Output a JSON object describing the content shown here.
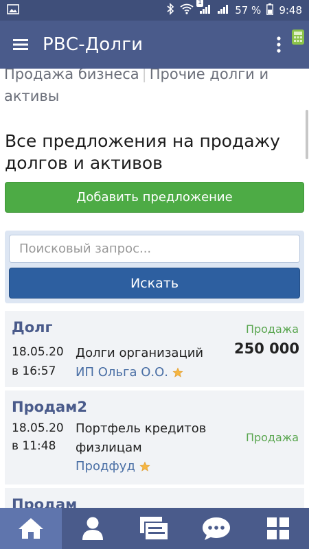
{
  "status_bar": {
    "battery": "57 %",
    "time": "9:48",
    "notification_count": "1"
  },
  "app_bar": {
    "title": "РВС-Долги"
  },
  "categories": {
    "item1": "Продажа бизнеса",
    "item2": "Прочие долги и активы"
  },
  "heading": "Все предложения на продажу долгов и активов",
  "add_button": "Добавить предложение",
  "search": {
    "placeholder": "Поисковый запрос...",
    "button": "Искать"
  },
  "listings": [
    {
      "title": "Долг",
      "date": "18.05.20",
      "time": "в 16:57",
      "description": "Долги организаций",
      "author": "ИП Ольга О.О.",
      "type": "Продажа",
      "price": "250 000"
    },
    {
      "title": "Продам2",
      "date": "18.05.20",
      "time": "в 11:48",
      "description_line1": "Портфель кредитов",
      "description_line2": "физлицам",
      "author": "Продфуд",
      "type": "Продажа"
    },
    {
      "title": "Продам"
    }
  ],
  "colors": {
    "primary": "#4a5b8b",
    "status_bar": "#3f4f7a",
    "add_button": "#4dab45",
    "search_button": "#2d5fa0",
    "type_text": "#5aa650",
    "author_text": "#4a6fa5"
  },
  "bottom_nav": [
    "home-icon",
    "profile-icon",
    "offers-icon",
    "chat-icon",
    "apps-icon"
  ]
}
